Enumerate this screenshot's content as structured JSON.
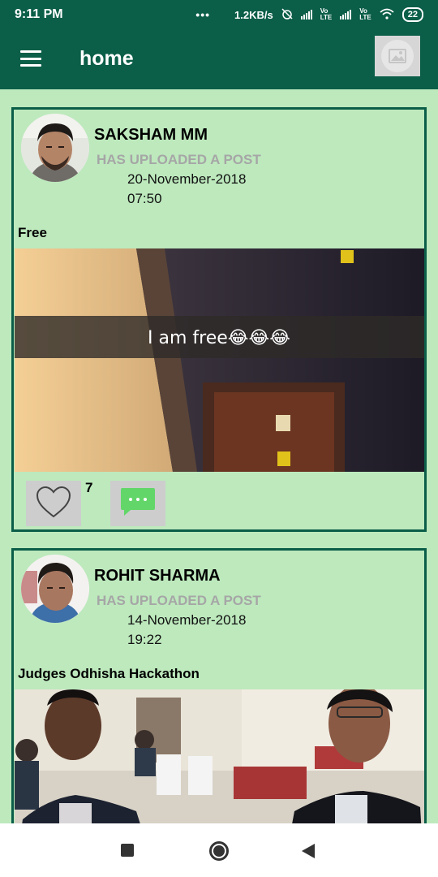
{
  "status_bar": {
    "time": "9:11 PM",
    "dots": "•••",
    "speed": "1.2KB/s",
    "battery": "22"
  },
  "app_bar": {
    "title": "home"
  },
  "posts": [
    {
      "user": "SAKSHAM MM",
      "action": "HAS UPLOADED A POST",
      "date": "20-November-2018",
      "time": "07:50",
      "caption": "Free",
      "image_text": "I am free😂😂😂",
      "likes": "7"
    },
    {
      "user": "ROHIT SHARMA",
      "action": "HAS UPLOADED A POST",
      "date": "14-November-2018",
      "time": "19:22",
      "caption": "Judges Odhisha Hackathon"
    }
  ],
  "colors": {
    "primary": "#0b5e48",
    "background": "#bde9bd",
    "muted_text": "#a6a6a6",
    "comment_green": "#63d66a"
  },
  "icons": [
    "menu-icon",
    "image-icon",
    "heart-icon",
    "comment-icon"
  ]
}
